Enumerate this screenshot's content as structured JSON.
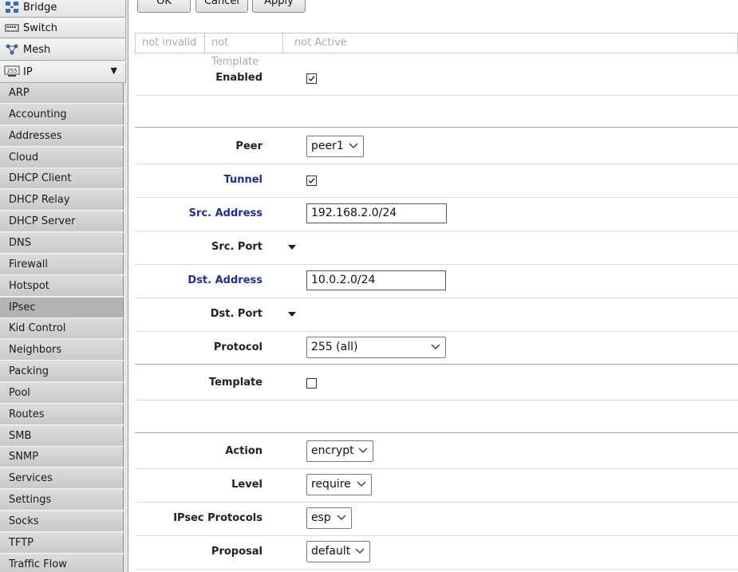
{
  "sidebar": {
    "top_items": [
      {
        "label": "Bridge",
        "icon": "bridge-icon"
      },
      {
        "label": "Switch",
        "icon": "switch-icon"
      },
      {
        "label": "Mesh",
        "icon": "mesh-icon"
      },
      {
        "label": "IP",
        "icon": "ip-icon",
        "expand_icon": "▼"
      }
    ],
    "items": [
      {
        "label": "ARP"
      },
      {
        "label": "Accounting"
      },
      {
        "label": "Addresses"
      },
      {
        "label": "Cloud"
      },
      {
        "label": "DHCP Client"
      },
      {
        "label": "DHCP Relay"
      },
      {
        "label": "DHCP Server"
      },
      {
        "label": "DNS"
      },
      {
        "label": "Firewall"
      },
      {
        "label": "Hotspot"
      },
      {
        "label": "IPsec",
        "active": true
      },
      {
        "label": "Kid Control"
      },
      {
        "label": "Neighbors"
      },
      {
        "label": "Packing"
      },
      {
        "label": "Pool"
      },
      {
        "label": "Routes"
      },
      {
        "label": "SMB"
      },
      {
        "label": "SNMP"
      },
      {
        "label": "Services"
      },
      {
        "label": "Settings"
      },
      {
        "label": "Socks"
      },
      {
        "label": "TFTP"
      },
      {
        "label": "Traffic Flow"
      }
    ]
  },
  "toolbar": {
    "ok_label": "OK",
    "cancel_label": "Cancel",
    "apply_label": "Apply"
  },
  "status": {
    "invalid": "not invalid",
    "template": "not Template",
    "active": "not Active"
  },
  "form": {
    "enabled": {
      "label": "Enabled",
      "checked": true
    },
    "peer": {
      "label": "Peer",
      "value": "peer1"
    },
    "tunnel": {
      "label": "Tunnel",
      "checked": true
    },
    "src_address": {
      "label": "Src. Address",
      "value": "192.168.2.0/24"
    },
    "src_port": {
      "label": "Src. Port"
    },
    "dst_address": {
      "label": "Dst. Address",
      "value": "10.0.2.0/24"
    },
    "dst_port": {
      "label": "Dst. Port"
    },
    "protocol": {
      "label": "Protocol",
      "value": "255 (all)"
    },
    "template": {
      "label": "Template",
      "checked": false
    },
    "action": {
      "label": "Action",
      "value": "encrypt"
    },
    "level": {
      "label": "Level",
      "value": "require"
    },
    "ipsec_protocols": {
      "label": "IPsec Protocols",
      "value": "esp"
    },
    "proposal": {
      "label": "Proposal",
      "value": "default"
    }
  },
  "colors": {
    "label_blue": "#1f2f8c",
    "sidebar_bg": "#e6e6e6",
    "status_text": "#aaaaaa"
  }
}
